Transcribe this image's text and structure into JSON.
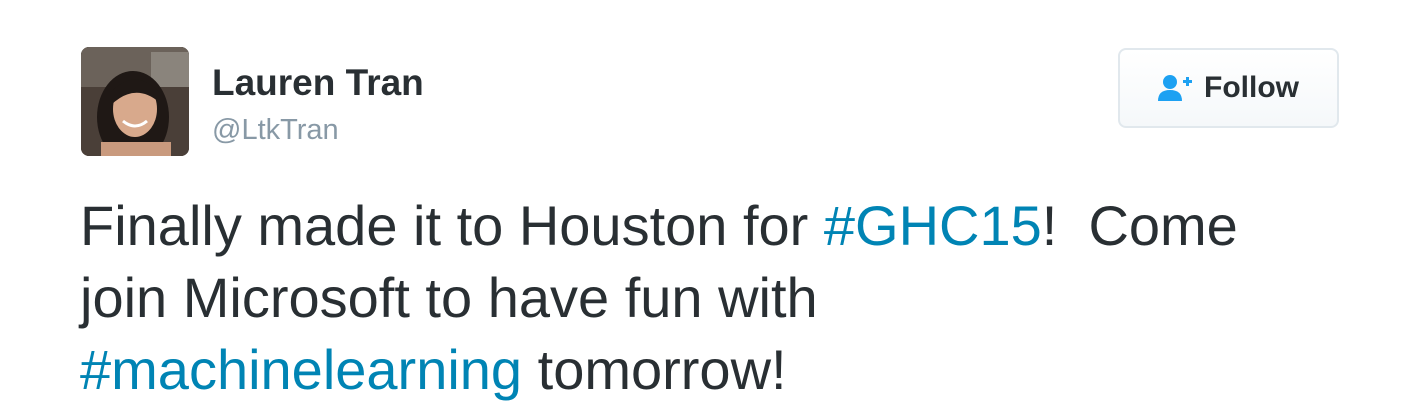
{
  "user": {
    "name": "Lauren Tran",
    "handle": "@LtkTran"
  },
  "follow_button": {
    "label": "Follow",
    "icon": "follow-person-plus-icon"
  },
  "tweet": {
    "line1_text": "Finally made it to Houston for ",
    "hashtag1": "#GHC15",
    "line1_end": "!  Come",
    "line2_text": "join Microsoft to have fun with",
    "hashtag2": "#machinelearning",
    "line3_end": " tomorrow!"
  },
  "colors": {
    "text": "#292f33",
    "muted": "#8899a6",
    "link": "#0084b4",
    "follow_icon": "#1da1f2"
  }
}
